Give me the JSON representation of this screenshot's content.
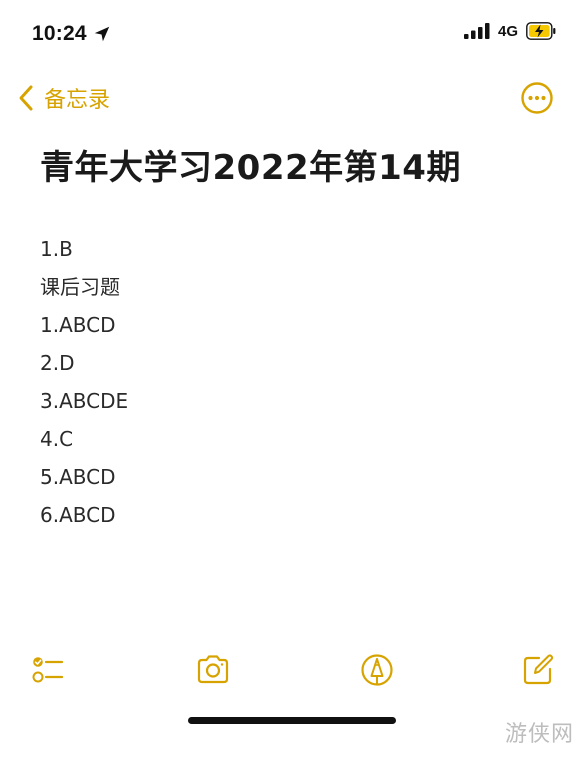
{
  "status_bar": {
    "time": "10:24",
    "network": "4G",
    "icons": [
      "location-arrow-icon",
      "signal-bars-icon",
      "battery-charging-icon"
    ]
  },
  "nav": {
    "back_label": "备忘录",
    "back_icon": "chevron-left-icon",
    "more_icon": "ellipsis-circle-icon"
  },
  "note": {
    "title": "青年大学习2022年第14期",
    "lines": [
      "1.B",
      "课后习题",
      "1.ABCD",
      "2.D",
      "3.ABCDE",
      "4.C",
      "5.ABCD",
      "6.ABCD"
    ]
  },
  "toolbar": {
    "icons": [
      "checklist-icon",
      "camera-icon",
      "markup-pen-icon",
      "compose-icon"
    ]
  },
  "watermark": "游侠网",
  "colors": {
    "accent": "#d7a300",
    "battery_fill": "#f5c800",
    "text": "#1a1a1a"
  }
}
